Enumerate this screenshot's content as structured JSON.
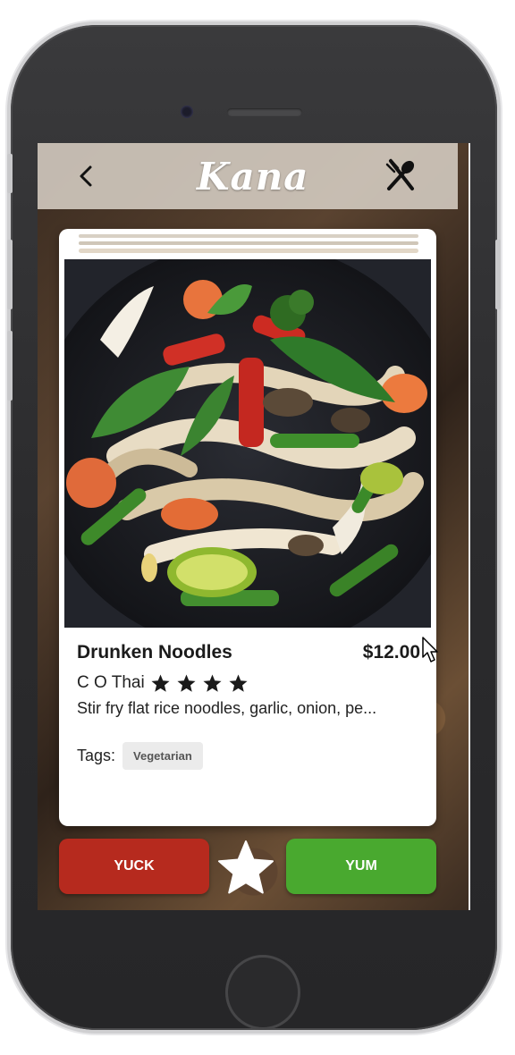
{
  "header": {
    "logo_text": "Kana",
    "back_icon": "chevron-left-icon",
    "menu_icon": "utensils-icon"
  },
  "card": {
    "dish_name": "Drunken Noodles",
    "price": "$12.00",
    "restaurant": "C O Thai",
    "rating_stars": 4,
    "description": "Stir fry flat rice noodles, garlic, onion, pe...",
    "tags_label": "Tags:",
    "tags": [
      "Vegetarian"
    ]
  },
  "actions": {
    "yuck_label": "YUCK",
    "yum_label": "YUM",
    "favorite_icon": "star-icon"
  },
  "colors": {
    "yuck": "#b62a1e",
    "yum": "#49a92f",
    "header_bg": "#d6cec4",
    "card_bg": "#ffffff"
  }
}
